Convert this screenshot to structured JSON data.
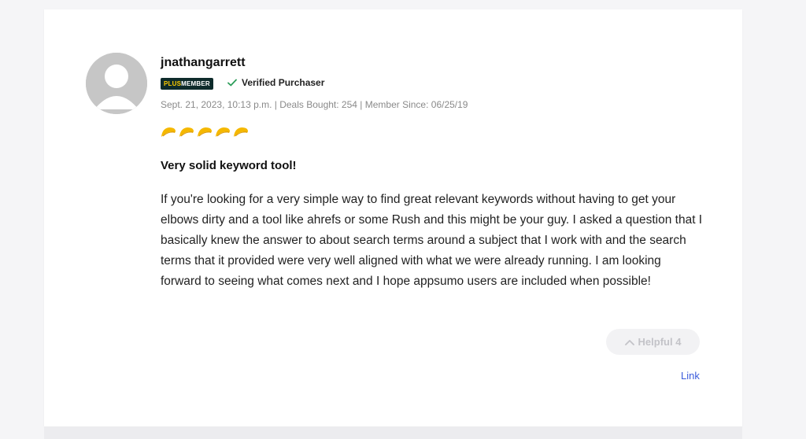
{
  "review": {
    "username": "jnathangarrett",
    "badge": {
      "plus": "PLUS",
      "member": "MEMBER"
    },
    "verified_label": "Verified Purchaser",
    "meta": "Sept. 21, 2023, 10:13 p.m. | Deals Bought: 254 | Member Since: 06/25/19",
    "rating": 5,
    "rating_icon": "taco-icon",
    "title": "Very solid keyword tool!",
    "body": "If you're looking for a very simple way to find great relevant keywords without having to get your elbows dirty and a tool like ahrefs or some Rush and this might be your guy. I asked a question that I basically knew the answer to about search terms around a subject that I work with and the search terms that it provided were very well aligned with what we were already running. I am looking forward to seeing what comes next and I hope appsumo users are included when possible!",
    "helpful_label": "Helpful 4",
    "link_label": "Link"
  },
  "colors": {
    "badge_bg": "#0e2b2b",
    "badge_plus": "#ffcc00",
    "verified_check": "#2e9e5b",
    "taco": "#f5b800",
    "link": "#3b5bdb"
  }
}
